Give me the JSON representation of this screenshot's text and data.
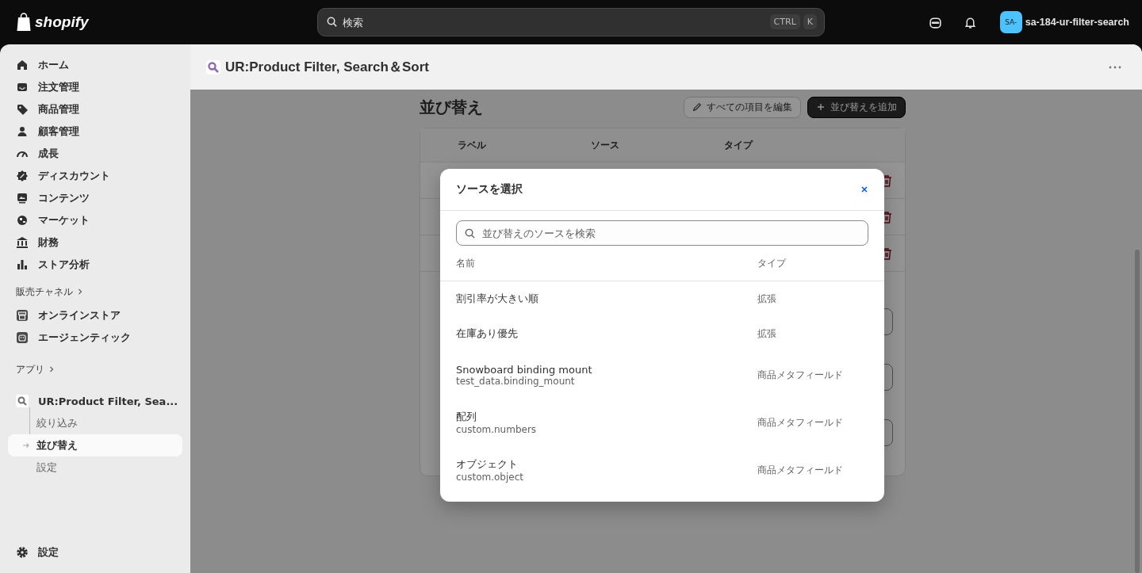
{
  "topbar": {
    "logo": "shopify",
    "search": {
      "placeholder": "検索",
      "keys": [
        "CTRL",
        "K"
      ]
    },
    "store": {
      "avatar": "SA-",
      "name": "sa-184-ur-filter-search"
    }
  },
  "sidebar": {
    "items": [
      {
        "label": "ホーム"
      },
      {
        "label": "注文管理"
      },
      {
        "label": "商品管理"
      },
      {
        "label": "顧客管理"
      },
      {
        "label": "成長"
      },
      {
        "label": "ディスカウント"
      },
      {
        "label": "コンテンツ"
      },
      {
        "label": "マーケット"
      },
      {
        "label": "財務"
      },
      {
        "label": "ストア分析"
      }
    ],
    "channels": {
      "heading": "販売チャネル",
      "items": [
        {
          "label": "オンラインストア"
        },
        {
          "label": "エージェンティック"
        }
      ]
    },
    "apps": {
      "heading": "アプリ",
      "app": {
        "label": "UR:Product Filter, Sea...",
        "children": [
          {
            "label": "絞り込み",
            "selected": false
          },
          {
            "label": "並び替え",
            "selected": true
          },
          {
            "label": "設定",
            "selected": false
          }
        ]
      }
    },
    "footer": {
      "label": "設定"
    }
  },
  "page_header": {
    "title": "UR:Product Filter, Search＆Sort"
  },
  "page": {
    "title": "並び替え",
    "buttons": [
      {
        "label": "すべての項目を編集",
        "kind": "secondary"
      },
      {
        "label": "並び替えを追加",
        "kind": "primary"
      }
    ],
    "columns": [
      "ラベル",
      "ソース",
      "タイプ"
    ]
  },
  "modal": {
    "title": "ソースを選択",
    "search": {
      "placeholder": "並び替えのソースを検索"
    },
    "columns": [
      "名前",
      "タイプ"
    ],
    "rows": [
      {
        "name": "割引率が大きい順",
        "type": "拡張"
      },
      {
        "name": "在庫あり優先",
        "type": "拡張"
      },
      {
        "name": "Snowboard binding mount",
        "key": "test_data.binding_mount",
        "type": "商品メタフィールド"
      },
      {
        "name": "配列",
        "key": "custom.numbers",
        "type": "商品メタフィールド"
      },
      {
        "name": "オブジェクト",
        "key": "custom.object",
        "type": "商品メタフィールド"
      }
    ]
  }
}
